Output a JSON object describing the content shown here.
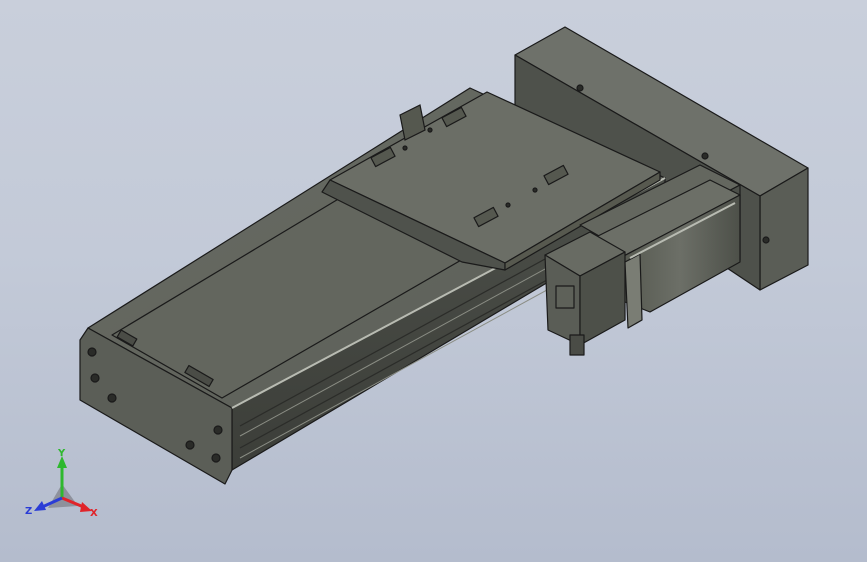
{
  "viewport": {
    "background_top": "#c9cfdb",
    "background_bottom": "#b4bccd"
  },
  "model": {
    "body_color": "#5d6059",
    "edge_color": "#1a1a1a",
    "highlight_color": "#b8bbb2"
  },
  "triad": {
    "x_label": "X",
    "y_label": "Y",
    "z_label": "Z",
    "x_color": "#e0242a",
    "y_color": "#2eb82e",
    "z_color": "#2a3cd6"
  }
}
